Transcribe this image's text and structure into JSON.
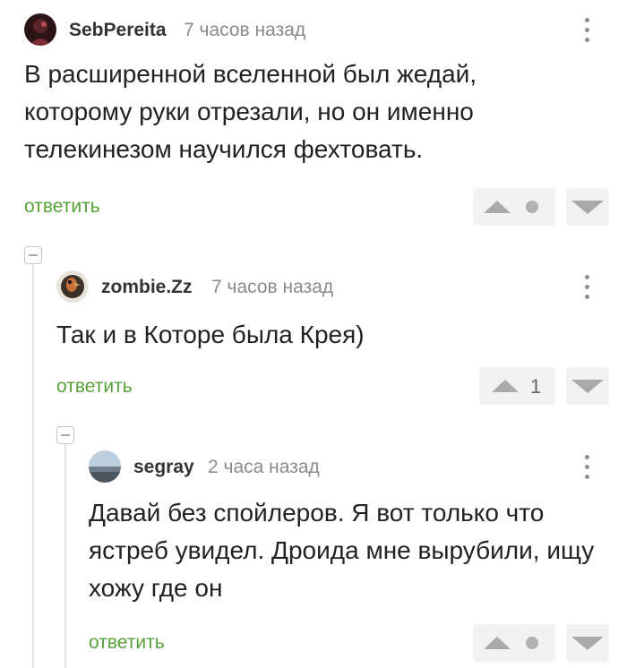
{
  "comments": [
    {
      "author": "SebPereita",
      "time": "7 часов назад",
      "text": "В расширенной вселенной был жедай, которому руки отрезали, но он именно телекинезом научился фехтовать.",
      "reply_label": "ответить",
      "rating": ""
    },
    {
      "author": "zombie.Zz",
      "time": "7 часов назад",
      "text": "Так и в Которе была Крея)",
      "reply_label": "ответить",
      "rating": "1"
    },
    {
      "author": "segray",
      "time": "2 часа назад",
      "text": "Давай без спойлеров. Я вот только что ястреб увидел. Дроида мне вырубили, ищу хожу где он",
      "reply_label": "ответить",
      "rating": ""
    }
  ],
  "colors": {
    "reply": "#58a13a",
    "author": "#333333",
    "time": "#8a8a8a",
    "vote_bg": "#f2f2f2",
    "arrow": "#a9a9a9"
  },
  "icons": {
    "menu": "vertical-ellipsis-icon",
    "upvote": "triangle-up-icon",
    "downvote": "triangle-down-icon",
    "collapse": "minus-square-icon",
    "neutral_rating": "dot-icon"
  }
}
